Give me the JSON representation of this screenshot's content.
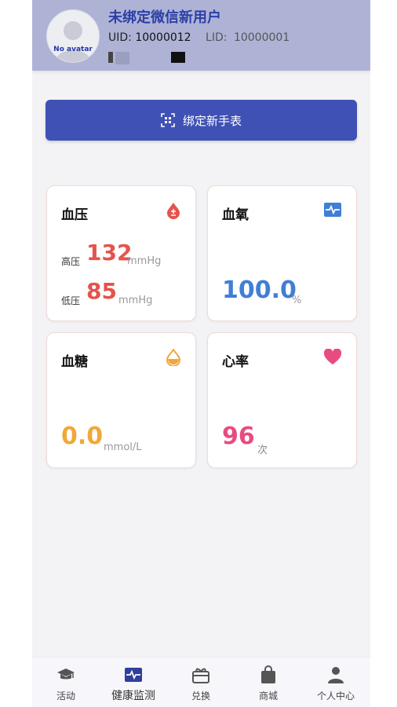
{
  "header": {
    "user_name": "未绑定微信新用户",
    "avatar_text": "No avatar",
    "uid_label": "UID:",
    "uid_value": "10000012",
    "lid_label": "LID:",
    "lid_value": "10000001"
  },
  "bind_button": {
    "label": "绑定新手表",
    "icon": "scan-qr-icon"
  },
  "cards": {
    "blood_pressure": {
      "title": "血压",
      "icon": "blood-drop-icon",
      "high_label": "高压",
      "high_value": "132",
      "high_unit": "mmHg",
      "low_label": "低压",
      "low_value": "85",
      "low_unit": "mmHg",
      "color": "#e5534b"
    },
    "blood_oxygen": {
      "title": "血氧",
      "icon": "pulse-monitor-icon",
      "value": "100.0",
      "unit": "%",
      "color": "#3f7fd6"
    },
    "blood_sugar": {
      "title": "血糖",
      "icon": "half-drop-icon",
      "value": "0.0",
      "unit": "mmol/L",
      "color": "#f0a83a"
    },
    "heart_rate": {
      "title": "心率",
      "icon": "heart-icon",
      "value": "96",
      "unit": "次",
      "color": "#e84c7f"
    }
  },
  "tabs": [
    {
      "label": "活动",
      "icon": "graduation-cap-icon",
      "active": false
    },
    {
      "label": "健康监测",
      "icon": "pulse-monitor-icon",
      "active": true
    },
    {
      "label": "兑换",
      "icon": "gift-card-icon",
      "active": false
    },
    {
      "label": "商城",
      "icon": "shopping-bag-icon",
      "active": false
    },
    {
      "label": "个人中心",
      "icon": "person-icon",
      "active": false
    }
  ]
}
